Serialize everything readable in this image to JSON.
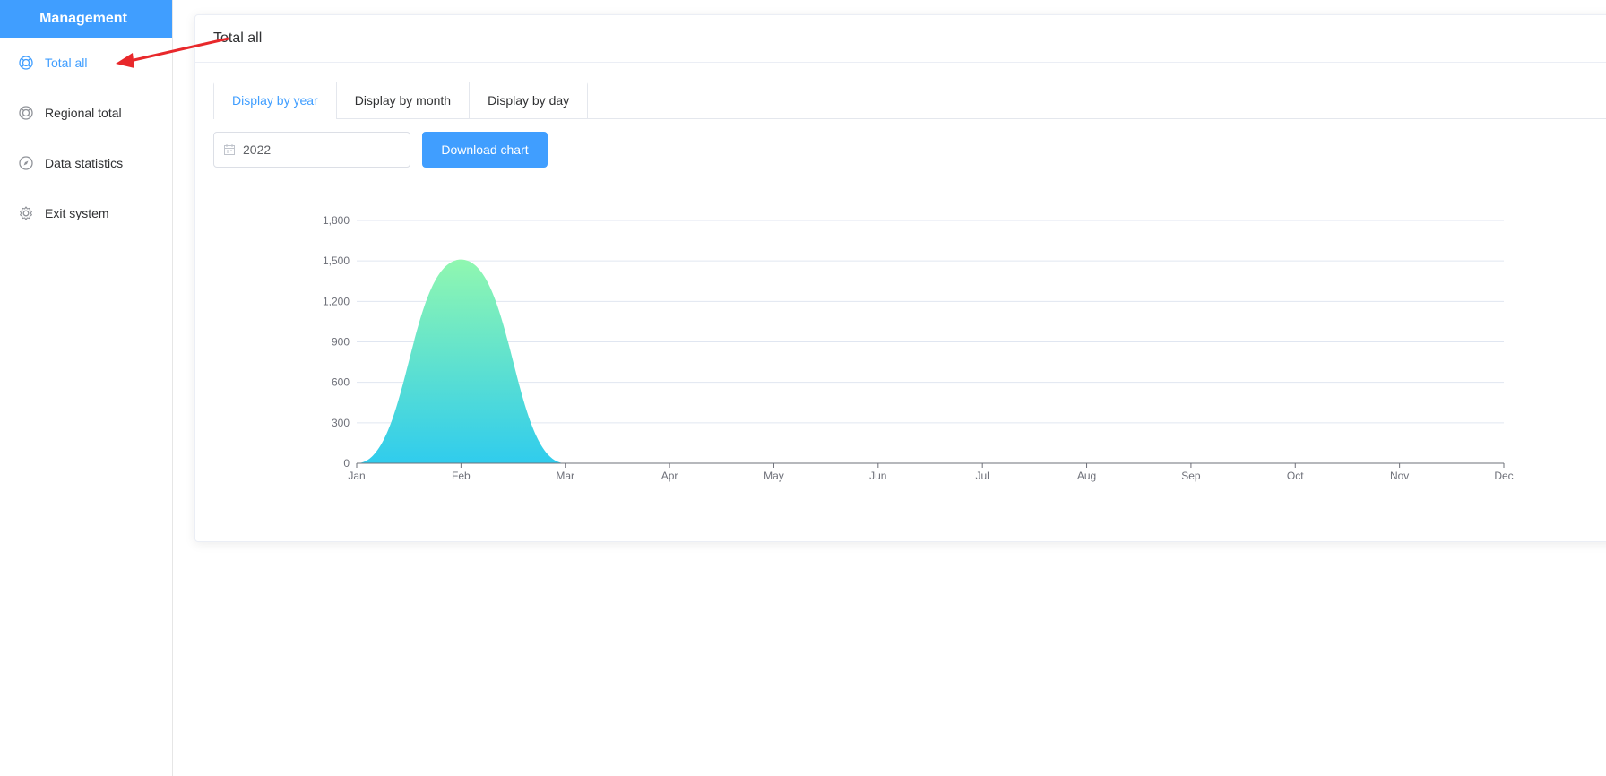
{
  "sidebar": {
    "brand": "Management",
    "items": [
      {
        "label": "Total all",
        "icon": "lifebuoy-icon",
        "active": true
      },
      {
        "label": "Regional total",
        "icon": "lifebuoy-icon",
        "active": false
      },
      {
        "label": "Data statistics",
        "icon": "compass-icon",
        "active": false
      },
      {
        "label": "Exit system",
        "icon": "gear-icon",
        "active": false
      }
    ]
  },
  "main": {
    "title": "Total all",
    "tabs": [
      {
        "label": "Display by year",
        "active": true
      },
      {
        "label": "Display by month",
        "active": false
      },
      {
        "label": "Display by day",
        "active": false
      }
    ],
    "date_value": "2022",
    "download_label": "Download chart"
  },
  "colors": {
    "accent": "#409eff",
    "area_top": "#90f7b0",
    "area_bottom": "#30cced",
    "annotation": "#e8282b"
  },
  "chart_data": {
    "type": "area",
    "categories": [
      "Jan",
      "Feb",
      "Mar",
      "Apr",
      "May",
      "Jun",
      "Jul",
      "Aug",
      "Sep",
      "Oct",
      "Nov",
      "Dec"
    ],
    "series": [
      {
        "values": [
          0,
          1510,
          0,
          0,
          0,
          0,
          0,
          0,
          0,
          0,
          0,
          0
        ]
      }
    ],
    "ylim": [
      0,
      1800
    ],
    "yticks": [
      "0",
      "300",
      "600",
      "900",
      "1,200",
      "1,500",
      "1,800"
    ],
    "ytick_values": [
      0,
      300,
      600,
      900,
      1200,
      1500,
      1800
    ],
    "grid": true,
    "smooth": true
  }
}
